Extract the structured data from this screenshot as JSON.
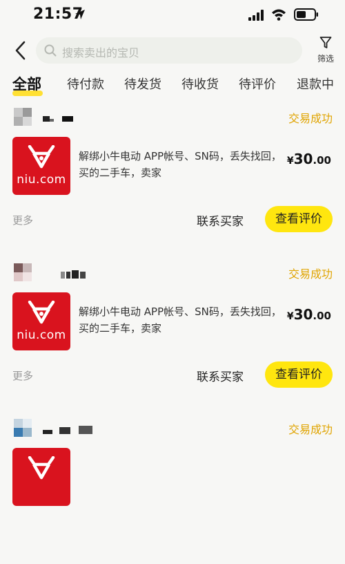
{
  "status_bar": {
    "time": "21:57"
  },
  "header": {
    "search_placeholder": "搜索卖出的宝贝",
    "filter_label": "筛选"
  },
  "tabs": [
    {
      "label": "全部",
      "active": true
    },
    {
      "label": "待付款"
    },
    {
      "label": "待发货"
    },
    {
      "label": "待收货"
    },
    {
      "label": "待评价"
    },
    {
      "label": "退款中"
    }
  ],
  "orders": [
    {
      "status": "交易成功",
      "thumb_brand": "niu.com",
      "title": "解绑小牛电动 APP帐号、SN码，丢失找回，买的二手车，卖家",
      "price_symbol": "¥",
      "price_int": "30",
      "price_dec": ".00",
      "more": "更多",
      "contact": "联系买家",
      "review": "查看评价"
    },
    {
      "status": "交易成功",
      "thumb_brand": "niu.com",
      "title": "解绑小牛电动 APP帐号、SN码，丢失找回，买的二手车，卖家",
      "price_symbol": "¥",
      "price_int": "30",
      "price_dec": ".00",
      "more": "更多",
      "contact": "联系买家",
      "review": "查看评价"
    },
    {
      "status": "交易成功",
      "thumb_brand": ""
    }
  ],
  "colors": {
    "accent_yellow": "#ffe60f",
    "status_gold": "#e0a400",
    "niu_red": "#d9131e"
  }
}
